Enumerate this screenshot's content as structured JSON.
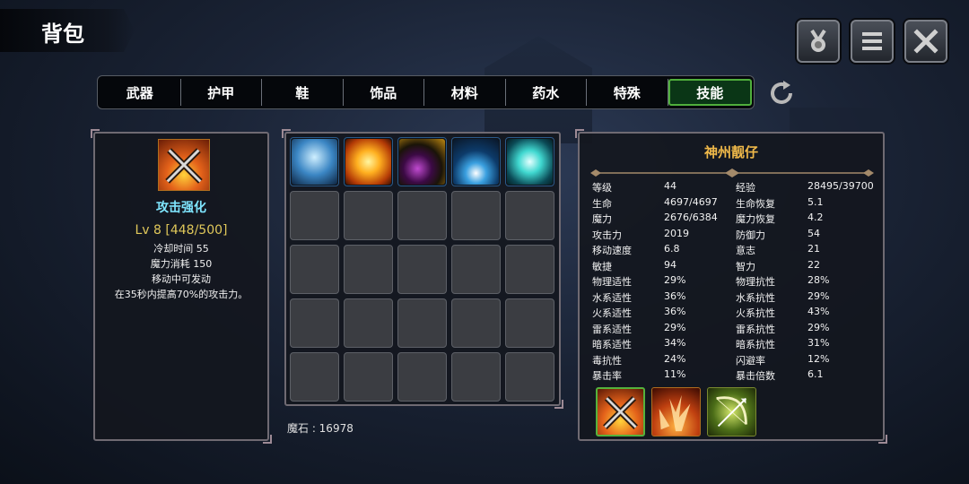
{
  "header": {
    "title": "背包"
  },
  "top_buttons": [
    {
      "icon": "medal-icon"
    },
    {
      "icon": "menu-icon"
    },
    {
      "icon": "close-icon"
    }
  ],
  "tabs": [
    {
      "label": "武器",
      "active": false
    },
    {
      "label": "护甲",
      "active": false
    },
    {
      "label": "鞋",
      "active": false
    },
    {
      "label": "饰品",
      "active": false
    },
    {
      "label": "材料",
      "active": false
    },
    {
      "label": "药水",
      "active": false
    },
    {
      "label": "特殊",
      "active": false
    },
    {
      "label": "技能",
      "active": true
    }
  ],
  "skill_detail": {
    "icon": "crossed-swords-icon",
    "name": "攻击强化",
    "level": "Lv 8 [448/500]",
    "lines": [
      "冷却时间 55",
      "魔力消耗 150",
      "移动中可发动",
      "在35秒内提高70%的攻击力。"
    ]
  },
  "inventory": {
    "slots": [
      {
        "icon": "spirit-figure-icon"
      },
      {
        "icon": "sun-burst-icon"
      },
      {
        "icon": "bomb-icon"
      },
      {
        "icon": "target-arrows-icon"
      },
      {
        "icon": "slash-burst-icon"
      }
    ],
    "magic_stone": "魔石 : 16978"
  },
  "character": {
    "name": "神州靓仔",
    "stats": [
      [
        "等级",
        "44",
        "经验",
        "28495/39700"
      ],
      [
        "生命",
        "4697/4697",
        "生命恢复",
        "5.1"
      ],
      [
        "魔力",
        "2676/6384",
        "魔力恢复",
        "4.2"
      ],
      [
        "攻击力",
        "2019",
        "防御力",
        "54"
      ],
      [
        "移动速度",
        "6.8",
        "意志",
        "21"
      ],
      [
        "敏捷",
        "94",
        "智力",
        "22"
      ],
      [
        "物理适性",
        "29%",
        "物理抗性",
        "28%"
      ],
      [
        "水系适性",
        "36%",
        "水系抗性",
        "29%"
      ],
      [
        "火系适性",
        "36%",
        "火系抗性",
        "43%"
      ],
      [
        "雷系适性",
        "29%",
        "雷系抗性",
        "29%"
      ],
      [
        "暗系适性",
        "34%",
        "暗系抗性",
        "31%"
      ],
      [
        "毒抗性",
        "24%",
        "闪避率",
        "12%"
      ],
      [
        "暴击率",
        "11%",
        "暴击倍数",
        "6.1"
      ]
    ],
    "equipped_skills": [
      {
        "icon": "crossed-swords-icon"
      },
      {
        "icon": "fire-claws-icon"
      },
      {
        "icon": "bow-icon"
      }
    ]
  },
  "colors": {
    "accent_green": "#4fae3c",
    "skill_name": "#7fe6ff",
    "level": "#e0c85a",
    "char_name": "#f0b94a"
  }
}
